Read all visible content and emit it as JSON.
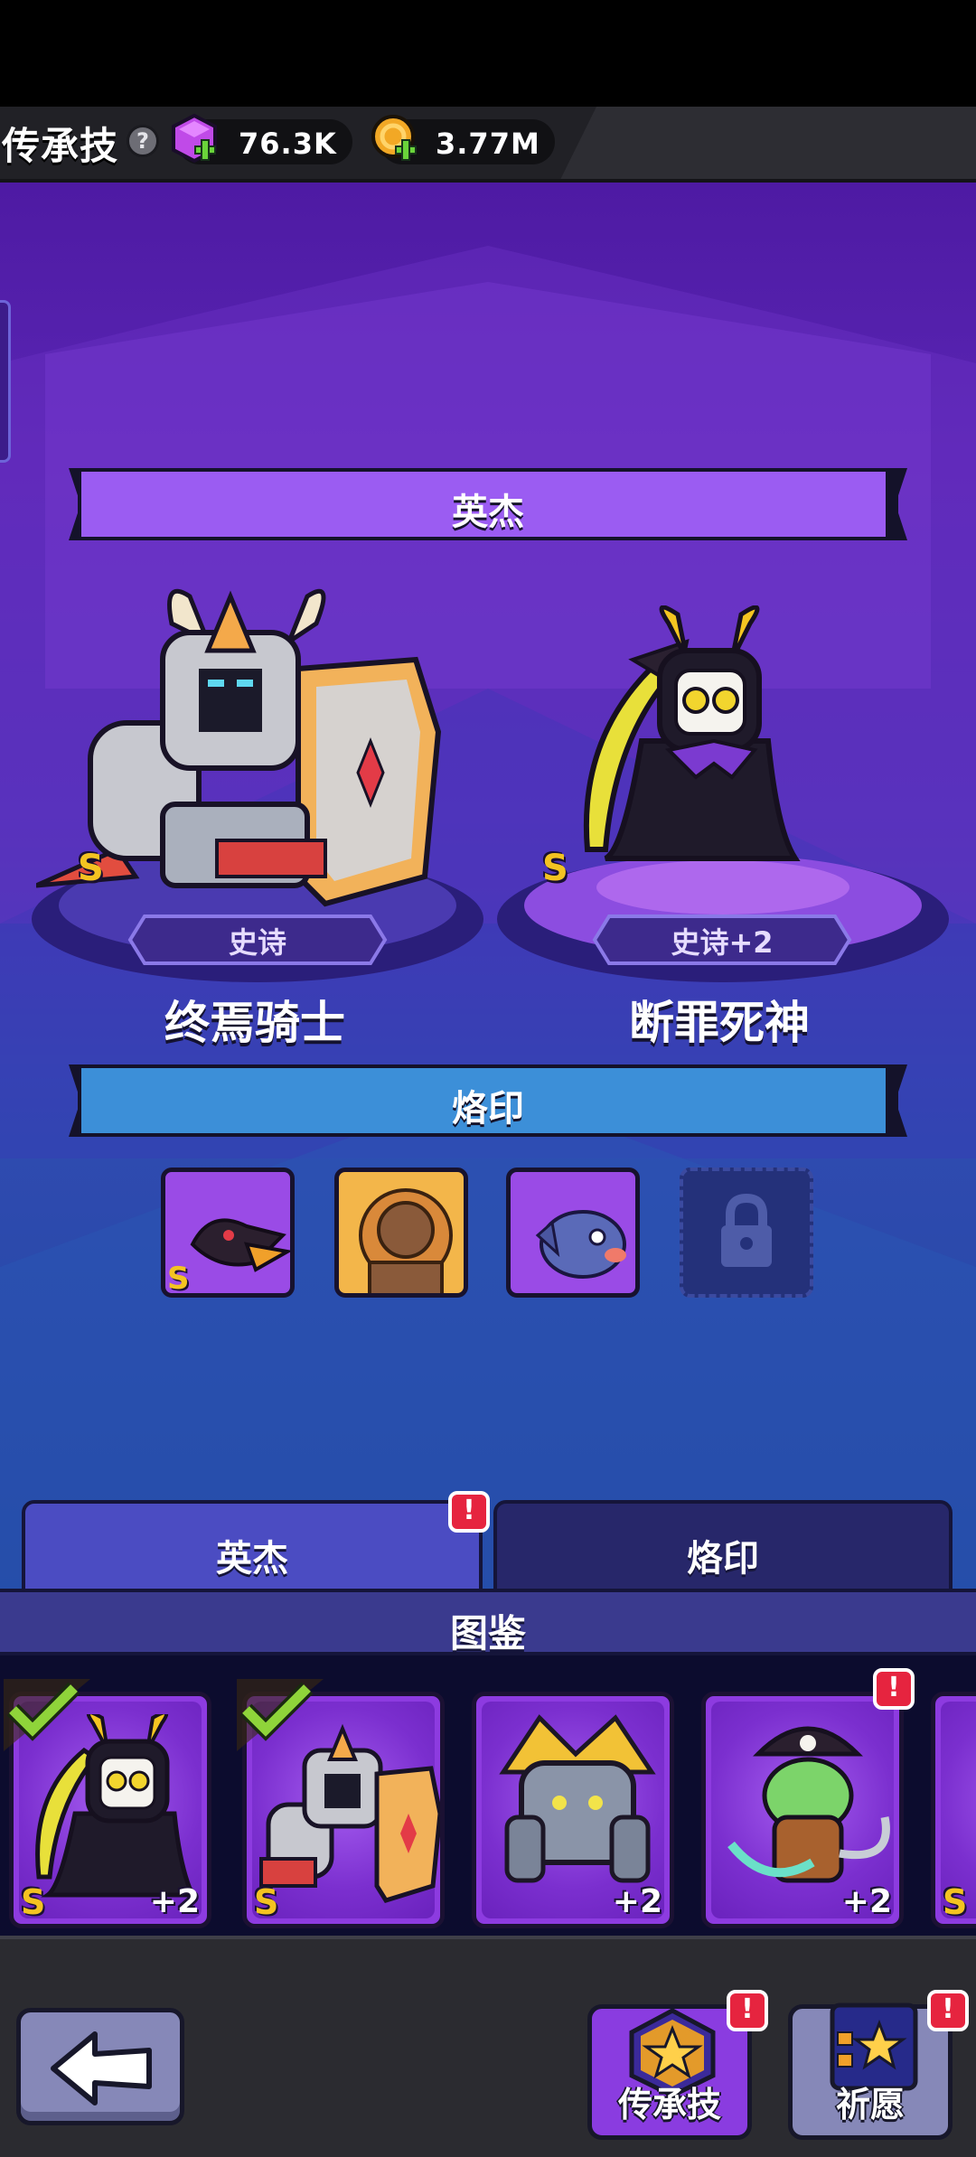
{
  "topbar": {
    "title": "传承技",
    "help_icon": "?",
    "gems": "76.3K",
    "coins": "3.77M"
  },
  "hero_section": {
    "title": "英杰",
    "heroes": [
      {
        "name": "终焉骑士",
        "rarity": "史诗",
        "grade": "S"
      },
      {
        "name": "断罪死神",
        "rarity": "史诗+2",
        "grade": "S"
      }
    ]
  },
  "brand_section": {
    "title": "烙印",
    "slots": [
      {
        "grade": "S",
        "locked": false
      },
      {
        "grade": "",
        "locked": false
      },
      {
        "grade": "",
        "locked": false
      },
      {
        "grade": "",
        "locked": true
      }
    ]
  },
  "tabs": [
    {
      "label": "英杰",
      "alert": "!"
    },
    {
      "label": "烙印"
    }
  ],
  "collection": {
    "title": "图鉴",
    "cards": [
      {
        "grade": "S",
        "level": "+2",
        "selected": true
      },
      {
        "grade": "S",
        "level": "",
        "selected": true
      },
      {
        "grade": "",
        "level": "+2",
        "selected": false
      },
      {
        "grade": "",
        "level": "+2",
        "selected": false,
        "alert": "!"
      },
      {
        "grade": "S",
        "level": "",
        "selected": false
      }
    ]
  },
  "bottom": {
    "inherit_label": "传承技",
    "inherit_alert": "!",
    "wish_label": "祈愿",
    "wish_alert": "!"
  },
  "colors": {
    "hero_ribbon": "#9b5cf2",
    "brand_ribbon": "#3c8fd8",
    "alert": "#e6243f",
    "grade_s": "#f4c321"
  }
}
